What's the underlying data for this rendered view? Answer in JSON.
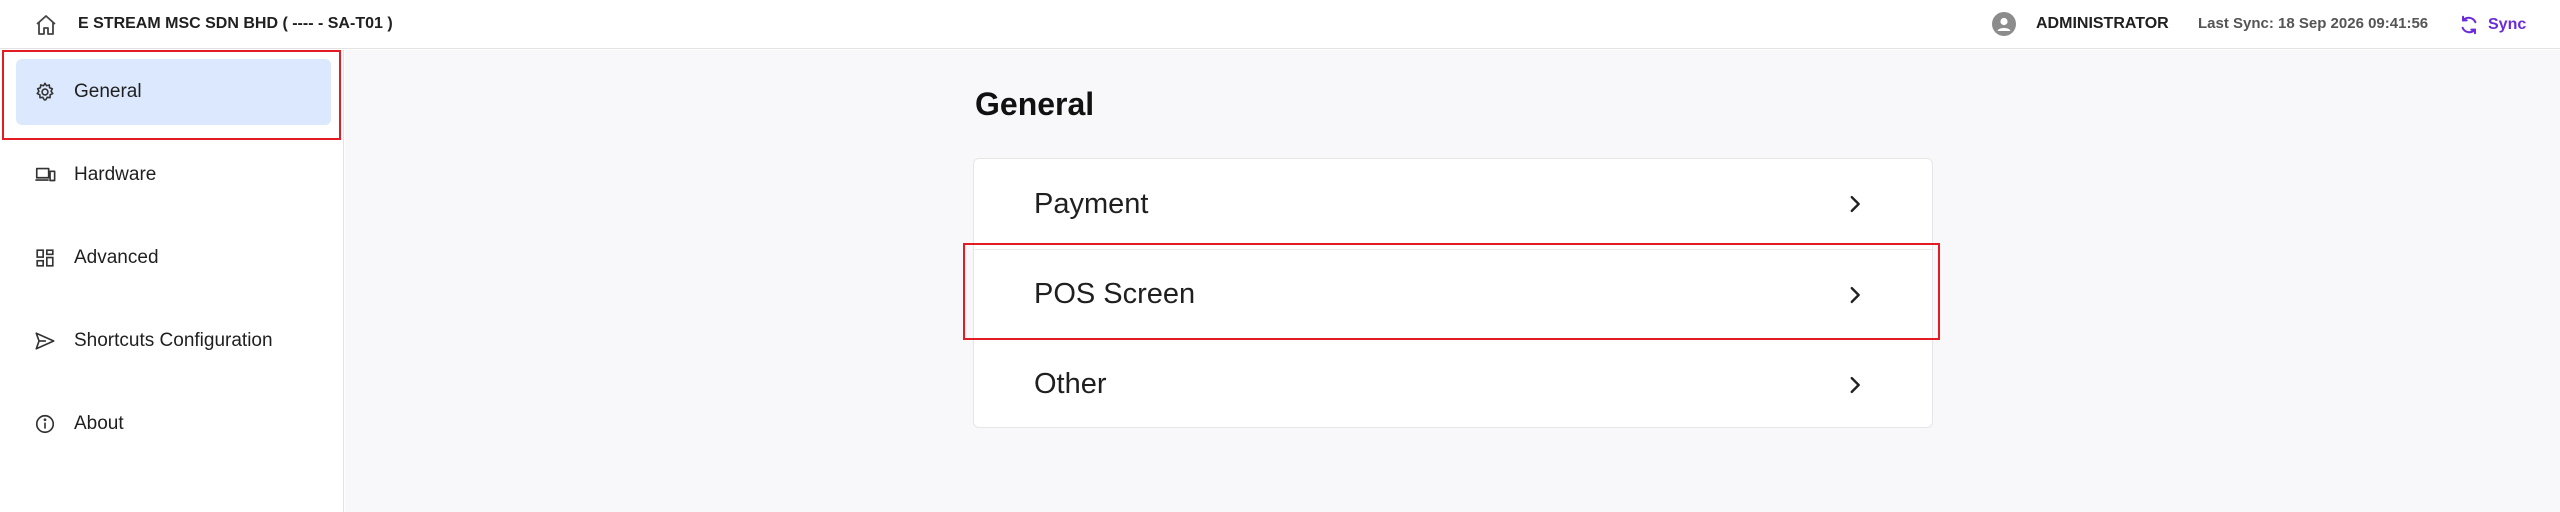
{
  "header": {
    "company": "E STREAM MSC SDN BHD ( ---- - SA-T01 )",
    "user": "ADMINISTRATOR",
    "last_sync": "Last Sync: 18 Sep 2026 09:41:56",
    "sync_label": "Sync",
    "accent_color": "#6a2bd8"
  },
  "sidebar": {
    "items": [
      {
        "label": "General",
        "icon": "gear-icon",
        "active": true
      },
      {
        "label": "Hardware",
        "icon": "devices-icon",
        "active": false
      },
      {
        "label": "Advanced",
        "icon": "grid-icon",
        "active": false
      },
      {
        "label": "Shortcuts Configuration",
        "icon": "send-icon",
        "active": false
      },
      {
        "label": "About",
        "icon": "info-icon",
        "active": false
      }
    ]
  },
  "main": {
    "title": "General",
    "rows": [
      {
        "label": "Payment"
      },
      {
        "label": "POS Screen"
      },
      {
        "label": "Other"
      }
    ]
  },
  "highlight_color": "#e31b23"
}
